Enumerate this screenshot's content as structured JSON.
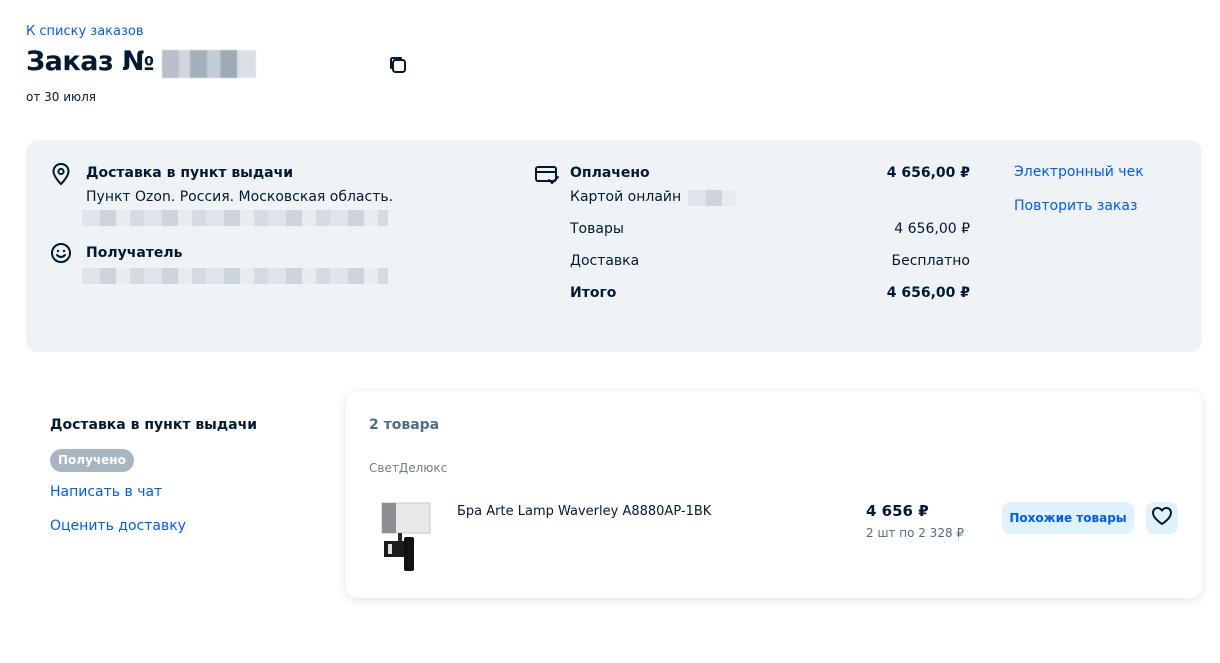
{
  "header": {
    "back_link": "К списку заказов",
    "title": "Заказ №",
    "date": "от 30 июля"
  },
  "delivery": {
    "title": "Доставка в пункт выдачи",
    "address": "Пункт Ozon. Россия. Московская область."
  },
  "recipient": {
    "title": "Получатель"
  },
  "payment": {
    "status": "Оплачено",
    "method": "Картой онлайн",
    "paid_amount": "4 656,00 ₽",
    "rows": [
      {
        "label": "Товары",
        "value": "4 656,00 ₽"
      },
      {
        "label": "Доставка",
        "value": "Бесплатно"
      },
      {
        "label": "Итого",
        "value": "4 656,00 ₽"
      }
    ]
  },
  "actions": {
    "receipt": "Электронный чек",
    "repeat": "Повторить заказ"
  },
  "shipment": {
    "title": "Доставка в пункт выдачи",
    "status": "Получено",
    "chat_link": "Написать в чат",
    "rate_link": "Оценить доставку"
  },
  "items": {
    "count_label": "2 товара",
    "seller": "СветДелюкс",
    "product": {
      "name": "Бра Arte Lamp Waverley A8880AP-1BK",
      "price": "4 656 ₽",
      "qty_price": "2 шт по 2 328 ₽"
    },
    "similar_button": "Похожие товары"
  },
  "icons": [
    "copy-icon",
    "location-pin-icon",
    "smile-icon",
    "card-check-icon",
    "heart-icon"
  ],
  "colors": {
    "link": "#005bff",
    "panel_bg": "#eff3f6",
    "badge_bg": "#a9b5c0",
    "button_bg": "#e0f2fd",
    "text": "#001a34"
  }
}
